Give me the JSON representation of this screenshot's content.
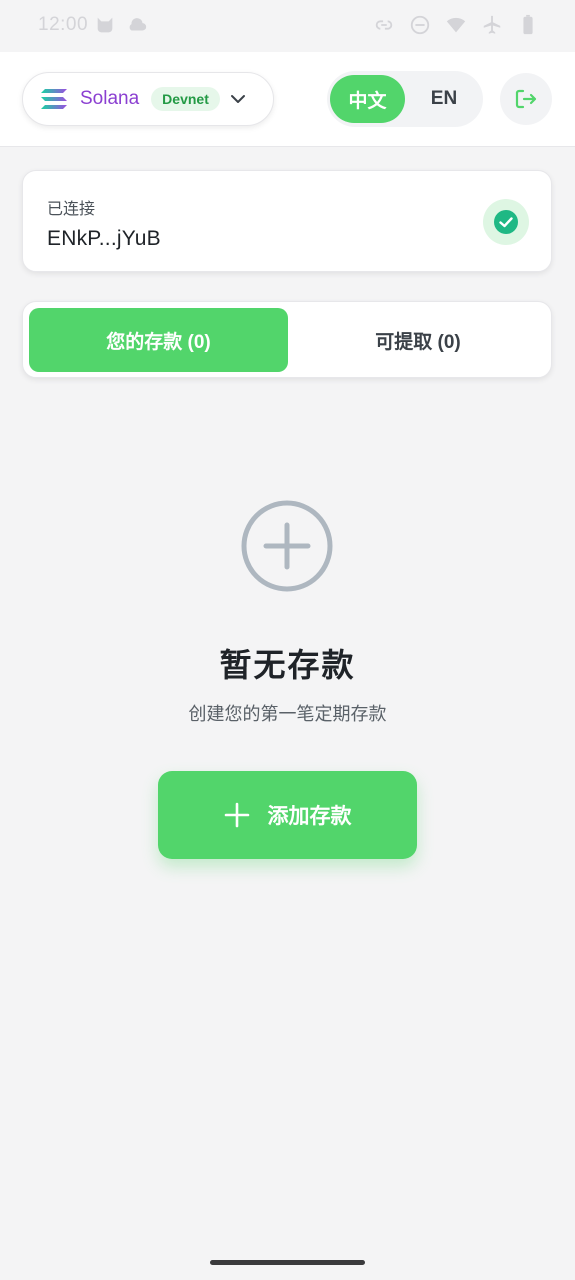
{
  "status_bar": {
    "time": "12:00",
    "left_icons": [
      "cat-icon",
      "cloud-icon"
    ],
    "right_icons": [
      "link-icon",
      "do-not-disturb-icon",
      "wifi-icon",
      "airplane-icon",
      "battery-icon"
    ]
  },
  "header": {
    "network": {
      "name": "Solana",
      "env": "Devnet",
      "logo": "solana-logo-icon",
      "chevron": "chevron-down-icon"
    },
    "language": {
      "options": [
        "中文",
        "EN"
      ],
      "selected": "中文"
    },
    "logout_icon": "logout-icon"
  },
  "connection": {
    "label": "已连接",
    "address": "ENkP...jYuB",
    "status_icon": "check-circle-icon"
  },
  "tabs": [
    {
      "label": "您的存款 (0)",
      "active": true
    },
    {
      "label": "可提取 (0)",
      "active": false
    }
  ],
  "empty_state": {
    "icon": "plus-circle-icon",
    "title": "暂无存款",
    "subtitle": "创建您的第一笔定期存款"
  },
  "add_button": {
    "label": "添加存款",
    "icon": "plus-icon"
  },
  "colors": {
    "accent": "#52d56b",
    "network_text": "#8b3fd1",
    "badge_bg": "#e6f7ea",
    "badge_text": "#239a45",
    "check": "#1fb884"
  }
}
